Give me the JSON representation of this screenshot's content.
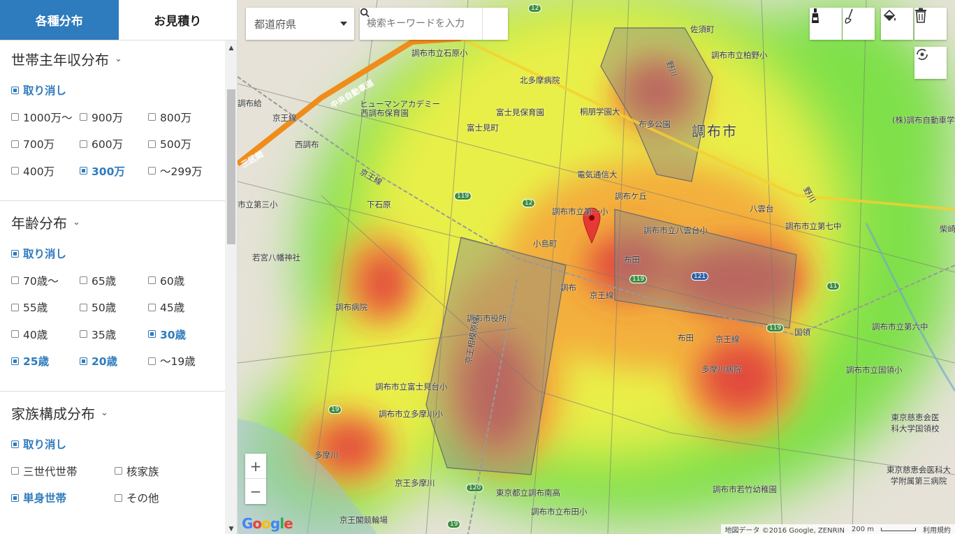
{
  "tabs": [
    {
      "label": "各種分布",
      "active": true
    },
    {
      "label": "お見積り",
      "active": false
    }
  ],
  "sections": {
    "income": {
      "title": "世帯主年収分布",
      "clear": "取り消し",
      "options": [
        {
          "label": "1000万〜",
          "checked": false
        },
        {
          "label": "900万",
          "checked": false
        },
        {
          "label": "800万",
          "checked": false
        },
        {
          "label": "700万",
          "checked": false
        },
        {
          "label": "600万",
          "checked": false
        },
        {
          "label": "500万",
          "checked": false
        },
        {
          "label": "400万",
          "checked": false
        },
        {
          "label": "300万",
          "checked": true
        },
        {
          "label": "〜299万",
          "checked": false
        }
      ]
    },
    "age": {
      "title": "年齢分布",
      "clear": "取り消し",
      "options": [
        {
          "label": "70歳〜",
          "checked": false
        },
        {
          "label": "65歳",
          "checked": false
        },
        {
          "label": "60歳",
          "checked": false
        },
        {
          "label": "55歳",
          "checked": false
        },
        {
          "label": "50歳",
          "checked": false
        },
        {
          "label": "45歳",
          "checked": false
        },
        {
          "label": "40歳",
          "checked": false
        },
        {
          "label": "35歳",
          "checked": false
        },
        {
          "label": "30歳",
          "checked": true
        },
        {
          "label": "25歳",
          "checked": true
        },
        {
          "label": "20歳",
          "checked": true
        },
        {
          "label": "〜19歳",
          "checked": false
        }
      ]
    },
    "family": {
      "title": "家族構成分布",
      "clear": "取り消し",
      "options": [
        {
          "label": "三世代世帯",
          "checked": false
        },
        {
          "label": "核家族",
          "checked": false
        },
        {
          "label": "単身世帯",
          "checked": true
        },
        {
          "label": "その他",
          "checked": false
        }
      ]
    }
  },
  "map": {
    "prefecture_label": "都道府県",
    "search_placeholder": "検索キーワードを入力",
    "labels": {
      "chofu_city": "調布市",
      "shibasaki": "柴崎",
      "sasuga": "佐須町",
      "kashiwano": "調布市立柏野小",
      "ishiwara": "調布市立石原小",
      "kitatama": "北多摩病院",
      "fujimi_hoiku": "富士見保育園",
      "toho_gakuen": "桐朋学園大",
      "fujimicho": "富士見町",
      "fuda_park": "布多公園",
      "jikei": "(株)調布自動車学",
      "human": "ヒューマンアカデミー",
      "nishichofu_hoiku": "西調布保育園",
      "nishichofu": "西調布",
      "denki_tsushin": "電気通信大",
      "chofugaoka": "調布ケ丘",
      "yakumodai": "八雲台",
      "daisanshō": "市立第三小",
      "shimoishihara": "下石原",
      "daiichi": "調布市立第一小",
      "yakumodai_sho": "調布市立八雲台小",
      "daishichi": "調布市立第七中",
      "wakamiya": "若宮八幡神社",
      "kojimacho": "小島町",
      "fuda": "布田",
      "chofu": "調布",
      "keio_line": "京王線",
      "keio_line2": "京王線",
      "chofu_hospital": "調布病院",
      "city_hall": "調布市役所",
      "fuda_station": "布田",
      "keio_line3": "京王線",
      "kokuryo": "国領",
      "dairoku": "調布市立第六中",
      "tamagawa_hospital": "多摩川病院",
      "kokuryo_sho": "調布市立国領小",
      "fujimidai": "調布市立富士見台小",
      "tamagawa_sho": "調布市立多摩川小",
      "jikei_univ": "東京慈恵会医科大学国領校",
      "jikei_hospital": "東京慈恵会医科大学附属第三病院",
      "tamagawa": "多摩川",
      "keio_tamagawa": "京王多摩川",
      "chofu_minami": "東京都立調布南高",
      "wakatake": "調布市若竹幼稚園",
      "fuda_sho": "調布市立布田小",
      "keio_sagamihara": "京王相模原線",
      "chuo_expressway": "中央自動車道",
      "keio_kaku": "京王閣競輪場",
      "kaku": "京王線",
      "chofu_kyu": "調布給",
      "nogawa": "野川",
      "nogawa2": "野川",
      "sanku": "三区間"
    },
    "routes": {
      "r12a": "12",
      "r12b": "12",
      "r119a": "119",
      "r119b": "119",
      "r119c": "119",
      "r121": "121",
      "r11": "11",
      "r19a": "19",
      "r19b": "19",
      "r120": "120"
    },
    "zoom_in": "+",
    "zoom_out": "−",
    "google": "Google",
    "attribution": "地図データ ©2016 Google, ZENRIN",
    "scale": "200 m",
    "terms": "利用規約"
  },
  "colors": {
    "accent": "#2e7bbd",
    "heat_high": "#e0403c",
    "heat_mid": "#f5c23c",
    "heat_low": "#7ee04a"
  }
}
